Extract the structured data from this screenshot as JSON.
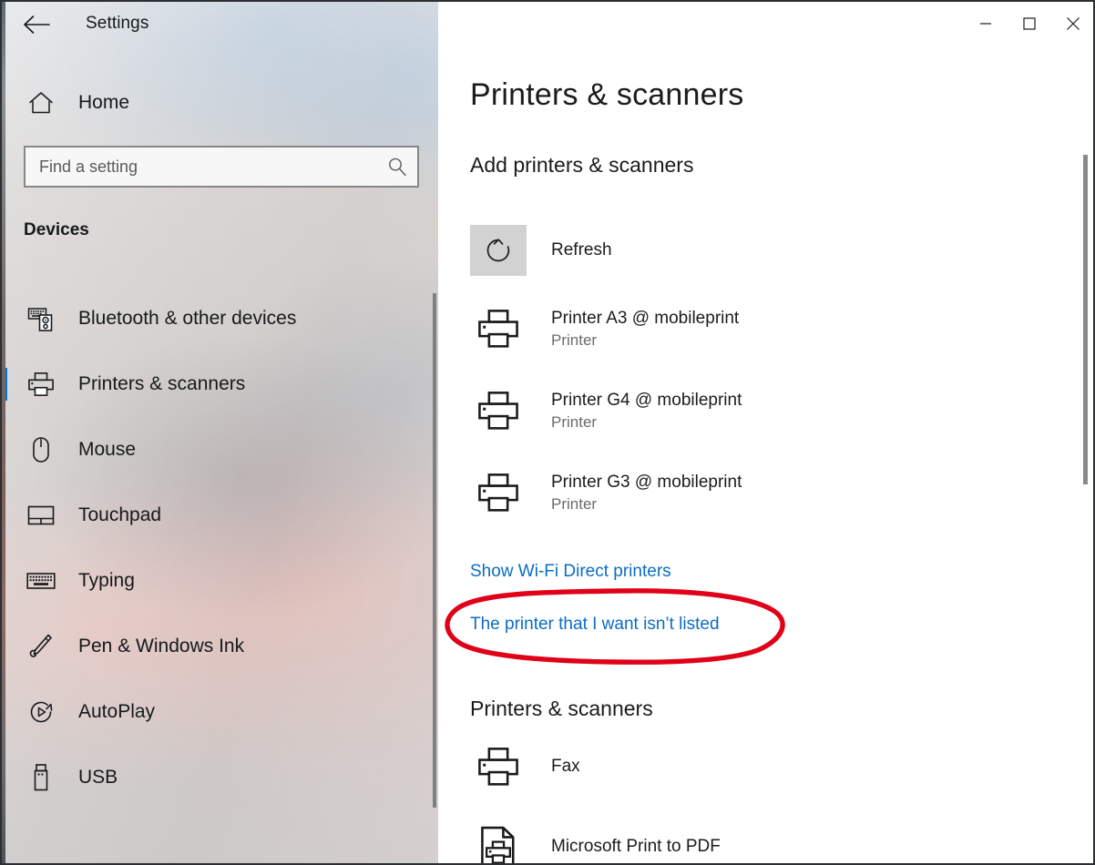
{
  "window": {
    "title": "Settings",
    "back_icon": "back-arrow-icon",
    "controls": {
      "minimize": "minimize-icon",
      "maximize": "maximize-icon",
      "close": "close-icon"
    }
  },
  "sidebar": {
    "home": {
      "label": "Home",
      "icon": "home-icon"
    },
    "search": {
      "placeholder": "Find a setting",
      "value": "",
      "icon": "search-icon"
    },
    "group_label": "Devices",
    "items": [
      {
        "label": "Bluetooth & other devices",
        "icon": "bluetooth-devices-icon",
        "selected": false
      },
      {
        "label": "Printers & scanners",
        "icon": "printer-icon",
        "selected": true
      },
      {
        "label": "Mouse",
        "icon": "mouse-icon",
        "selected": false
      },
      {
        "label": "Touchpad",
        "icon": "touchpad-icon",
        "selected": false
      },
      {
        "label": "Typing",
        "icon": "keyboard-icon",
        "selected": false
      },
      {
        "label": "Pen & Windows Ink",
        "icon": "pen-icon",
        "selected": false
      },
      {
        "label": "AutoPlay",
        "icon": "autoplay-icon",
        "selected": false
      },
      {
        "label": "USB",
        "icon": "usb-icon",
        "selected": false
      }
    ]
  },
  "main": {
    "page_title": "Printers & scanners",
    "add_section": {
      "heading": "Add printers & scanners",
      "refresh": {
        "label": "Refresh",
        "icon": "refresh-icon"
      },
      "discovered": [
        {
          "name": "Printer A3 @ mobileprint",
          "type": "Printer",
          "icon": "printer-icon"
        },
        {
          "name": "Printer G4 @ mobileprint",
          "type": "Printer",
          "icon": "printer-icon"
        },
        {
          "name": "Printer G3 @ mobileprint",
          "type": "Printer",
          "icon": "printer-icon"
        }
      ],
      "links": [
        {
          "label": "Show Wi-Fi Direct printers"
        },
        {
          "label": "The printer that I want isn’t listed"
        }
      ]
    },
    "list_section": {
      "heading": "Printers & scanners",
      "devices": [
        {
          "name": "Fax",
          "icon": "printer-icon"
        },
        {
          "name": "Microsoft Print to PDF",
          "icon": "print-to-pdf-icon"
        }
      ]
    }
  },
  "annotation": {
    "shape": "ellipse-highlight",
    "color": "#e00018",
    "target": "The printer that I want isn’t listed"
  },
  "colors": {
    "accent": "#0078d7",
    "link": "#0a6cc4",
    "annotation_red": "#e00018",
    "refresh_button_bg": "#d2d2d2",
    "subtitle_gray": "#6b6b6b"
  }
}
